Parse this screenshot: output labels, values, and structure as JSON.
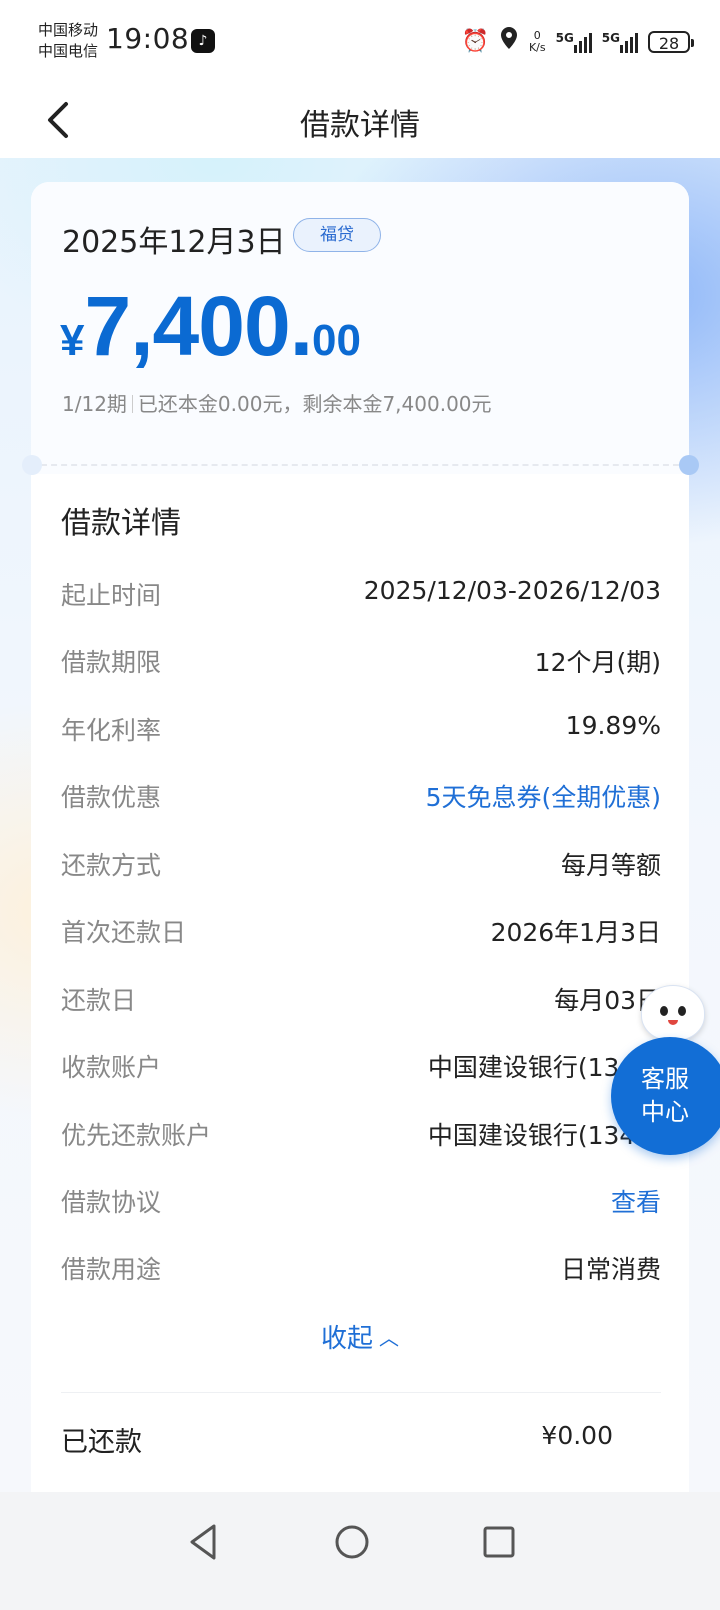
{
  "status_bar": {
    "carrier1": "中国移动",
    "carrier2": "中国电信",
    "time": "19:08",
    "speed_value": "0",
    "speed_unit": "K/s",
    "net1": "5G",
    "net2": "5G",
    "battery": "28"
  },
  "nav": {
    "title": "借款详情"
  },
  "loan": {
    "date": "2025年12月3日",
    "tag": "福贷",
    "currency_symbol": "¥",
    "amount_int": "7,400.",
    "amount_dec": "00",
    "term_progress": "1/12期",
    "principal_summary": "已还本金0.00元，剩余本金7,400.00元"
  },
  "details": {
    "title": "借款详情",
    "rows": [
      {
        "label": "起止时间",
        "value": "2025/12/03-2026/12/03"
      },
      {
        "label": "借款期限",
        "value": "12个月(期)"
      },
      {
        "label": "年化利率",
        "value": "19.89%"
      },
      {
        "label": "借款优惠",
        "value": "5天免息券(全期优惠)"
      },
      {
        "label": "还款方式",
        "value": "每月等额"
      },
      {
        "label": "首次还款日",
        "value": "2026年1月3日"
      },
      {
        "label": "还款日",
        "value": "每月03日"
      },
      {
        "label": "收款账户",
        "value": "中国建设银行(1343)"
      },
      {
        "label": "优先还款账户",
        "value": "中国建设银行(1343)"
      },
      {
        "label": "借款协议",
        "value": "查看"
      },
      {
        "label": "借款用途",
        "value": "日常消费"
      }
    ],
    "collapse_label": "收起",
    "collapse_icon": "chevron-up-icon"
  },
  "repaid": {
    "label": "已还款",
    "value": "¥0.00"
  },
  "customer_service": {
    "line1": "客服",
    "line2": "中心"
  },
  "colors": {
    "accent": "#0b6ad2",
    "link": "#1f6fd6",
    "cs_bubble": "#126ed6"
  }
}
